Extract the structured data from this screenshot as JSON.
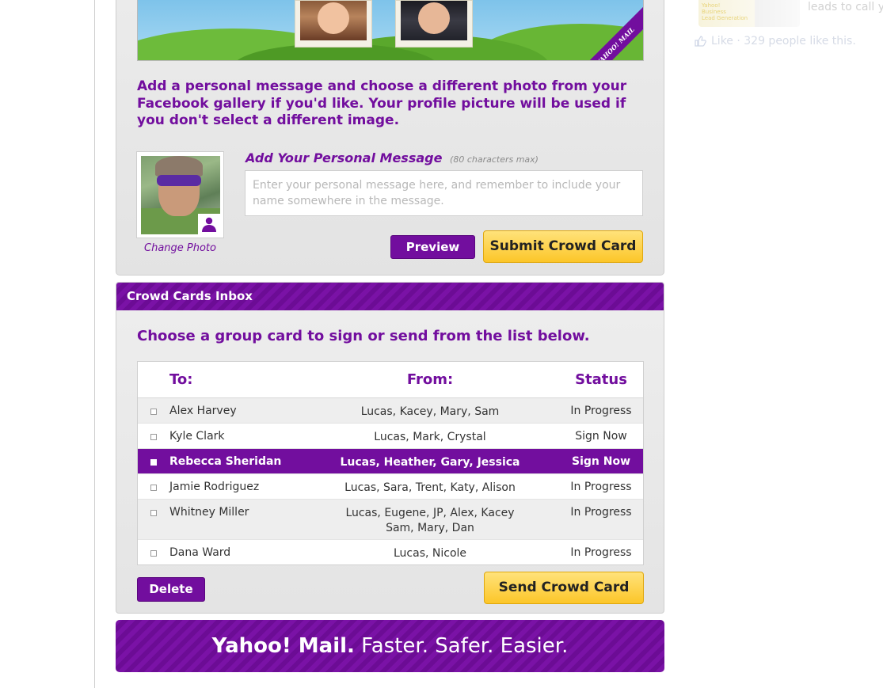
{
  "sidebar": {
    "ad_caption": "leads to call y",
    "ad_tiny_lines": [
      "Yahoo!",
      "Business",
      "Lead Generation"
    ],
    "like_text": "Like · 329 people like this."
  },
  "hero": {
    "ribbon_text": "YAHOO! MAIL"
  },
  "compose": {
    "intro": "Add a personal message and choose a different photo from your Facebook gallery if you'd like. Your profile picture will be used if you don't select a different image.",
    "change_photo": "Change Photo",
    "message_label": "Add Your Personal Message",
    "message_hint": "(80 characters max)",
    "message_placeholder": "Enter your personal message here, and remember to include your name somewhere in the message.",
    "message_value": "",
    "preview_label": "Preview",
    "submit_label": "Submit Crowd Card"
  },
  "inbox": {
    "title": "Crowd Cards Inbox",
    "intro": "Choose a group card to sign or send from the list below.",
    "columns": {
      "to": "To:",
      "from": "From:",
      "status": "Status"
    },
    "rows": [
      {
        "to": "Alex Harvey",
        "from": [
          "Lucas, Kacey, Mary, Sam"
        ],
        "status": "In Progress"
      },
      {
        "to": "Kyle Clark",
        "from": [
          "Lucas, Mark, Crystal"
        ],
        "status": "Sign Now"
      },
      {
        "to": "Rebecca Sheridan",
        "from": [
          "Lucas, Heather, Gary, Jessica"
        ],
        "status": "Sign Now"
      },
      {
        "to": "Jamie Rodriguez",
        "from": [
          "Lucas, Sara, Trent, Katy, Alison"
        ],
        "status": "In Progress"
      },
      {
        "to": "Whitney Miller",
        "from": [
          "Lucas, Eugene, JP, Alex, Kacey",
          "Sam, Mary, Dan"
        ],
        "status": "In Progress"
      },
      {
        "to": "Dana Ward",
        "from": [
          "Lucas, Nicole"
        ],
        "status": "In Progress"
      }
    ],
    "delete_label": "Delete",
    "send_label": "Send Crowd Card"
  },
  "footer": {
    "brand": "Yahoo! Mail.",
    "tagline": "Faster. Safer. Easier."
  },
  "colors": {
    "accent_purple": "#720e9e",
    "button_yellow": "#fcc629"
  }
}
